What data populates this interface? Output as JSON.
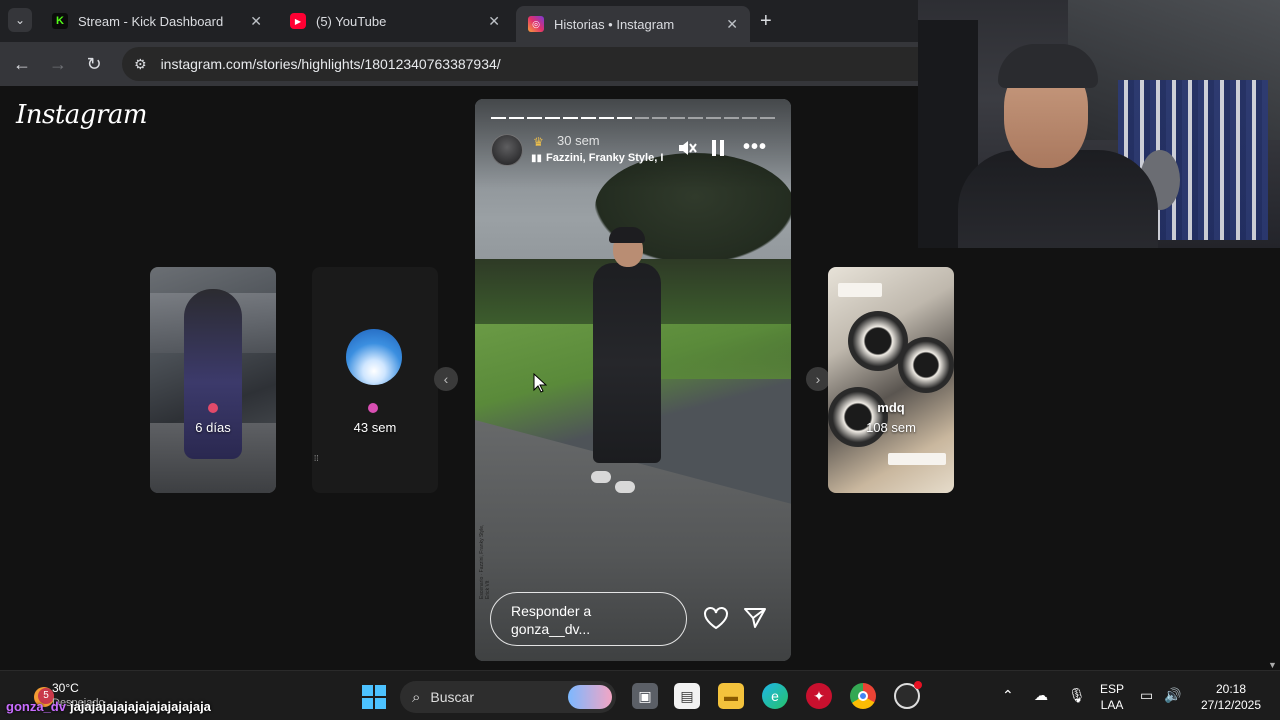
{
  "browser": {
    "tabs": [
      {
        "title": "Stream - Kick Dashboard",
        "favicon": "kick-icon",
        "color": "#53fc18"
      },
      {
        "title": "(5) YouTube",
        "favicon": "youtube-icon",
        "color": "#ff0033"
      },
      {
        "title": "Historias • Instagram",
        "favicon": "instagram-icon",
        "color": "#e1306c"
      }
    ],
    "active_tab": 2,
    "url": "instagram.com/stories/highlights/18012340763387934/"
  },
  "instagram": {
    "logo": "Instagram",
    "prev_stories": [
      {
        "label": "6 días"
      },
      {
        "label": "43 sem"
      }
    ],
    "current_story": {
      "time": "30 sem",
      "music": "Fazzini, Franky Style, I",
      "progress_segments": 16,
      "progress_done": 8,
      "reply_placeholder": "Responder a gonza__dv...",
      "credit_text": "Escenario · Fazzini, Franky Style, Erick Vlt"
    },
    "next_stories": [
      {
        "name": "mdq",
        "label": "108 sem"
      }
    ]
  },
  "taskbar": {
    "weather_temp": "30°C",
    "weather_desc": "Despejado",
    "search_label": "Buscar",
    "language_line1": "ESP",
    "language_line2": "LAA",
    "time": "20:18",
    "date": "27/12/2025",
    "notification_count": "5"
  },
  "overlay_chat": {
    "user": "gonza_dv",
    "message": "jajajajajajajajajajajajaja"
  }
}
